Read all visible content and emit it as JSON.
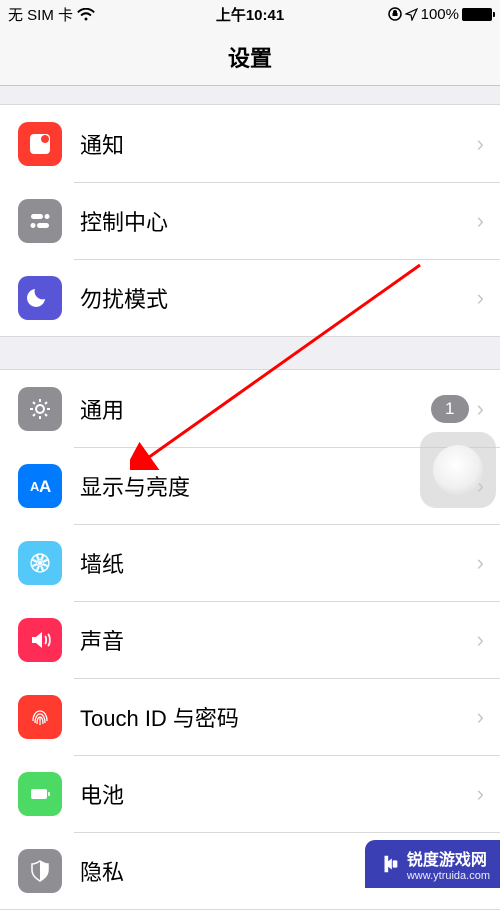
{
  "status": {
    "carrier": "无 SIM 卡",
    "time": "上午10:41",
    "battery_pct": "100%"
  },
  "nav": {
    "title": "设置"
  },
  "group1": [
    {
      "key": "notifications",
      "label": "通知",
      "icon_bg": "#ff3b30"
    },
    {
      "key": "control-center",
      "label": "控制中心",
      "icon_bg": "#8e8e93"
    },
    {
      "key": "dnd",
      "label": "勿扰模式",
      "icon_bg": "#5856d6"
    }
  ],
  "group2": [
    {
      "key": "general",
      "label": "通用",
      "icon_bg": "#8e8e93",
      "badge": "1"
    },
    {
      "key": "display",
      "label": "显示与亮度",
      "icon_bg": "#007aff"
    },
    {
      "key": "wallpaper",
      "label": "墙纸",
      "icon_bg": "#54c8f9"
    },
    {
      "key": "sounds",
      "label": "声音",
      "icon_bg": "#ff2d55"
    },
    {
      "key": "touchid",
      "label": "Touch ID 与密码",
      "icon_bg": "#ff3b30"
    },
    {
      "key": "battery",
      "label": "电池",
      "icon_bg": "#4cd964"
    },
    {
      "key": "privacy",
      "label": "隐私",
      "icon_bg": "#8e8e93"
    }
  ],
  "watermark": {
    "brand": "锐度游戏网",
    "url": "www.ytruida.com"
  }
}
